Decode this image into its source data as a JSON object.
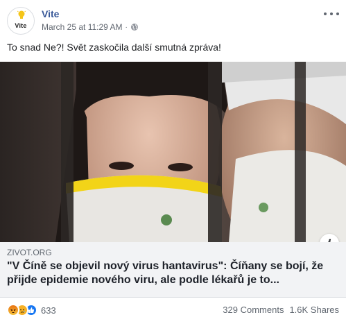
{
  "post": {
    "page_name": "Vite",
    "avatar_text": "Vite",
    "timestamp": "March 25 at 11:29 AM",
    "separator": "·",
    "text": "To snad Ne?! Svět zaskočila další smutná zpráva!"
  },
  "link": {
    "domain": "ZIVOT.ORG",
    "headline": "\"V Číně se objevil nový virus hantavirus\": Číňany se bojí, že přijde epidemie nového viru, ale podle lékařů je to...",
    "info_icon": "i"
  },
  "footer": {
    "reaction_icons": [
      "angry-icon",
      "sad-icon",
      "like-icon"
    ],
    "reaction_count": "633",
    "comments": "329 Comments",
    "shares": "1.6K Shares"
  },
  "colors": {
    "page_name": "#385898",
    "link_bg": "#f2f3f5",
    "like_blue": "#1877f2"
  }
}
